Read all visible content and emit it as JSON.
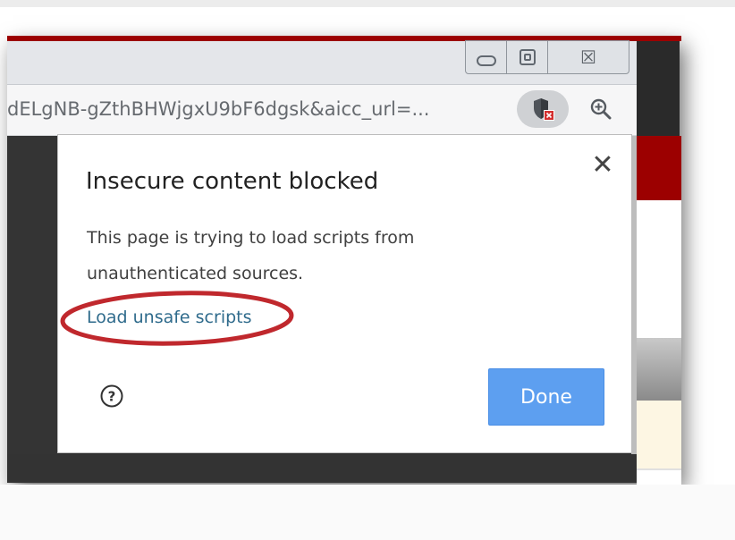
{
  "browser": {
    "url_text": "dELgNB-gZthBHWjgxU9bF6dgsk&aicc_url=...",
    "window_controls": {
      "minimize_icon": "minimize-icon",
      "maximize_icon": "restore-icon",
      "close_icon": "close-icon",
      "close_glyph": "☒"
    },
    "shield_icon": "blocked-shield-icon",
    "zoom_icon": "zoom-in-icon",
    "accent_color": "#9c0000"
  },
  "popup": {
    "title": "Insecure content blocked",
    "body_line1": "This page is trying to load scripts from",
    "body_line2": "unauthenticated sources.",
    "link_label": "Load unsafe scripts",
    "close_glyph": "✕",
    "help_glyph": "?",
    "done_label": "Done",
    "highlight_color": "#c0282d",
    "done_color": "#5d9ff0"
  }
}
